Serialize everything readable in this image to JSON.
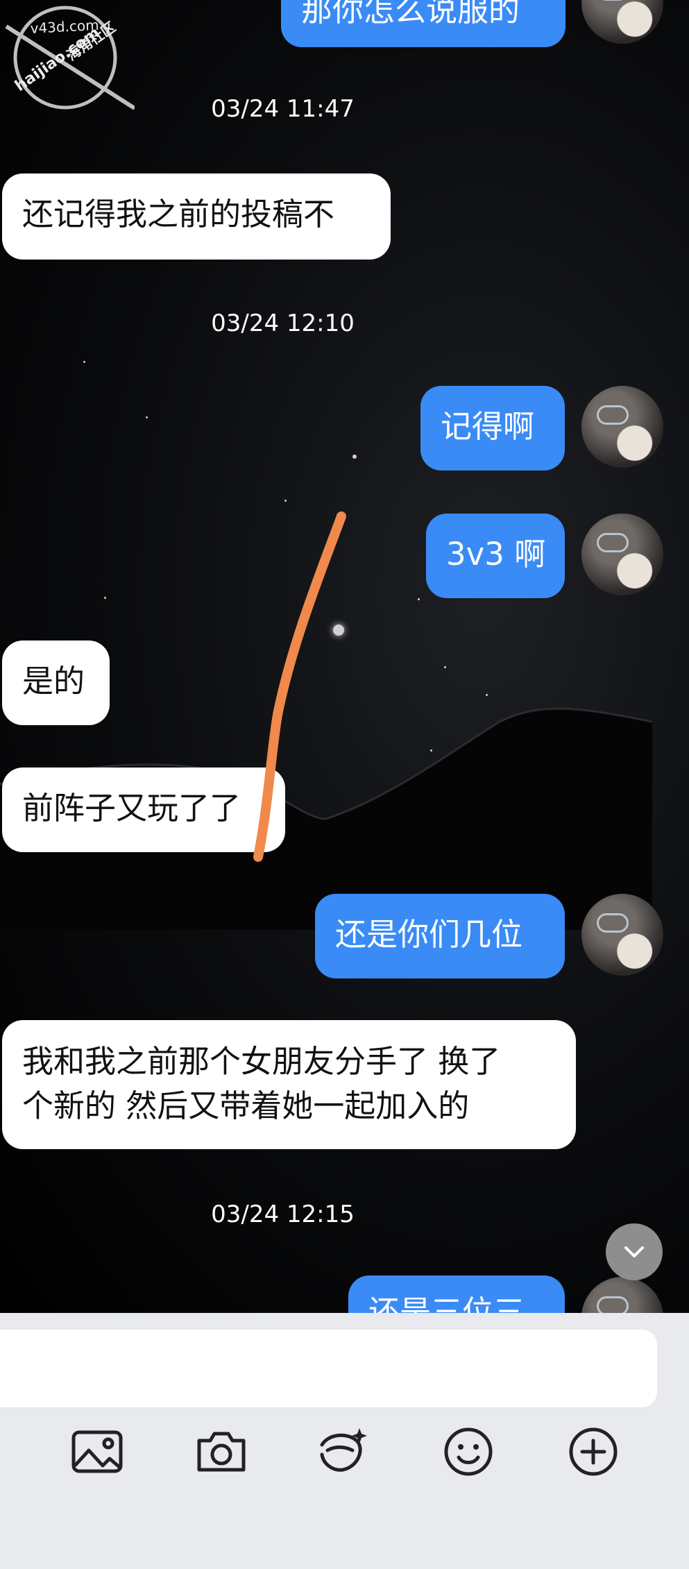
{
  "watermark": {
    "line1": "v43d.com",
    "line2": "haijiao.com",
    "line3": "海角社区"
  },
  "messages": [
    {
      "text": "那你怎么说服的"
    },
    {
      "time": "03/24 11:47"
    },
    {
      "text": "还记得我之前的投稿不"
    },
    {
      "time": "03/24 12:10"
    },
    {
      "text": "记得啊"
    },
    {
      "text": "3v3 啊"
    },
    {
      "text": "是的"
    },
    {
      "text": "前阵子又玩了了"
    },
    {
      "text": "还是你们几位"
    },
    {
      "text_line1": "我和我之前那个女朋友分手了 换了",
      "text_line2": "个新的 然后又带着她一起加入的"
    },
    {
      "time": "03/24 12:15"
    },
    {
      "text": "还是三位三"
    }
  ],
  "input": {
    "placeholder": ""
  },
  "toolbar": {
    "icons": [
      "image-icon",
      "camera-icon",
      "sticker-icon",
      "emoji-icon",
      "plus-icon"
    ]
  },
  "colors": {
    "outgoing_bubble": "#3a8bf5",
    "incoming_bubble": "#ffffff",
    "annotation_stroke": "#f0894b"
  }
}
